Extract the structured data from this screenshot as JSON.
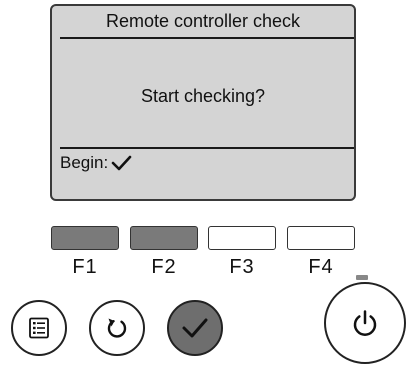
{
  "screen": {
    "title": "Remote controller check",
    "prompt": "Start checking?",
    "begin_label": "Begin:",
    "begin_icon": "check-icon"
  },
  "function_keys": [
    {
      "label": "F1",
      "active": true
    },
    {
      "label": "F2",
      "active": true
    },
    {
      "label": "F3",
      "active": false
    },
    {
      "label": "F4",
      "active": false
    }
  ],
  "buttons": {
    "menu_icon": "menu-list-icon",
    "return_icon": "return-arrow-icon",
    "confirm_icon": "check-icon",
    "power_icon": "power-icon"
  },
  "colors": {
    "lcd_background": "#d4d4d4",
    "function_key_active": "#7a7a7a",
    "confirm_button": "#6e6e6e"
  }
}
